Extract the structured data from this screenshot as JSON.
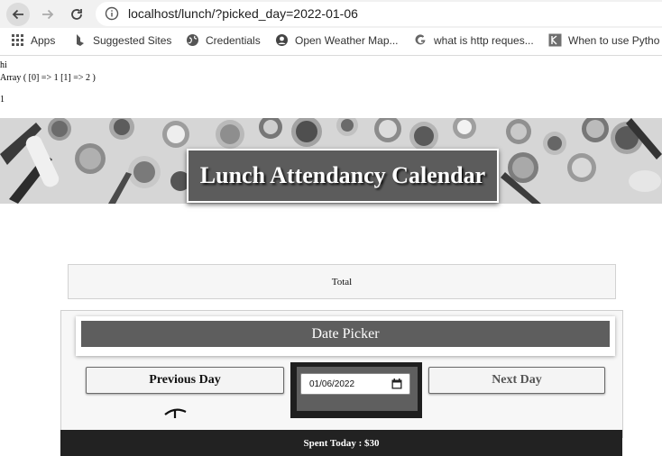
{
  "browser": {
    "url": "localhost/lunch/?picked_day=2022-01-06",
    "bookmarks": [
      {
        "label": "Apps",
        "icon": "apps-grid-icon"
      },
      {
        "label": "Suggested Sites",
        "icon": "bing-icon"
      },
      {
        "label": "Credentials",
        "icon": "globe-icon"
      },
      {
        "label": "Open Weather Map...",
        "icon": "openweather-icon"
      },
      {
        "label": "what is http reques...",
        "icon": "google-icon"
      },
      {
        "label": "When to use Pytho",
        "icon": "doc-bookmark-icon"
      }
    ]
  },
  "debug": {
    "line1": "hi",
    "line2": "Array ( [0] => 1 [1] => 2 )",
    "line3": "1"
  },
  "banner": {
    "title": "Lunch Attendancy Calendar"
  },
  "total": {
    "label": "Total"
  },
  "date_picker": {
    "header": "Date Picker",
    "prev_label": "Previous Day",
    "next_label": "Next Day",
    "date_value": "01/06/2022"
  },
  "spent": {
    "label": "Spent Today : $30"
  },
  "colors": {
    "title_bg": "#5c5c5c",
    "header_bg": "#5e5e5e",
    "date_frame": "#1f1f1f",
    "footer_bg": "#222222"
  }
}
